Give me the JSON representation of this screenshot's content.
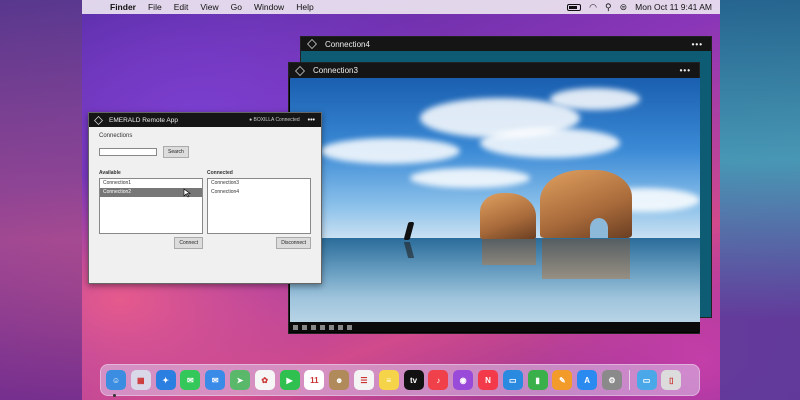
{
  "menubar": {
    "apple_glyph": "",
    "app_name": "Finder",
    "items": [
      "File",
      "Edit",
      "View",
      "Go",
      "Window",
      "Help"
    ],
    "date_time": "Mon Oct 11  9:41 AM"
  },
  "windows": {
    "connection4": {
      "title": "Connection4",
      "more": "•••"
    },
    "connection3": {
      "title": "Connection3",
      "more": "•••"
    }
  },
  "emerald_app": {
    "title": "EMERALD Remote App",
    "status": "● BOXILLA Connected",
    "more": "•••",
    "connections_label": "Connections",
    "search_value": "",
    "search_button": "Search",
    "available_label": "Available",
    "available_items": [
      "Connection1",
      "Connection2"
    ],
    "available_selected": 1,
    "connected_label": "Connected",
    "connected_items": [
      "Connection3",
      "Connection4"
    ],
    "connect_button": "Connect",
    "disconnect_button": "Disconnect"
  },
  "dock": {
    "apps": [
      {
        "name": "finder-icon",
        "color": "#3a8de0",
        "glyph": "☺"
      },
      {
        "name": "launchpad-icon",
        "color": "#d8d8e8",
        "glyph": "▦"
      },
      {
        "name": "safari-icon",
        "color": "#2a7fe0",
        "glyph": "✦"
      },
      {
        "name": "messages-icon",
        "color": "#34c759",
        "glyph": "✉"
      },
      {
        "name": "mail-icon",
        "color": "#3a8ae8",
        "glyph": "✉"
      },
      {
        "name": "maps-icon",
        "color": "#5ab86a",
        "glyph": "➤"
      },
      {
        "name": "photos-icon",
        "color": "#f6f6f6",
        "glyph": "✿"
      },
      {
        "name": "facetime-icon",
        "color": "#30c050",
        "glyph": "▶"
      },
      {
        "name": "calendar-icon",
        "color": "#ffffff",
        "glyph": "11"
      },
      {
        "name": "contacts-icon",
        "color": "#b08a5a",
        "glyph": "☻"
      },
      {
        "name": "reminders-icon",
        "color": "#f4f4f4",
        "glyph": "☰"
      },
      {
        "name": "notes-icon",
        "color": "#f6d44a",
        "glyph": "≡"
      },
      {
        "name": "tv-icon",
        "color": "#111111",
        "glyph": "tv"
      },
      {
        "name": "music-icon",
        "color": "#f0404a",
        "glyph": "♪"
      },
      {
        "name": "podcasts-icon",
        "color": "#9a4ad8",
        "glyph": "◉"
      },
      {
        "name": "news-icon",
        "color": "#f23a4a",
        "glyph": "N"
      },
      {
        "name": "keynote-icon",
        "color": "#2a8ae0",
        "glyph": "▭"
      },
      {
        "name": "numbers-icon",
        "color": "#3ab04a",
        "glyph": "▮"
      },
      {
        "name": "pages-icon",
        "color": "#f29a2a",
        "glyph": "✎"
      },
      {
        "name": "appstore-icon",
        "color": "#2a8af0",
        "glyph": "A"
      },
      {
        "name": "system-preferences-icon",
        "color": "#8a8a8a",
        "glyph": "⚙"
      }
    ],
    "trailing": [
      {
        "name": "downloads-folder-icon",
        "color": "#4aa8e8",
        "glyph": "▭"
      },
      {
        "name": "trash-icon",
        "color": "#dcdcdc",
        "glyph": "▯"
      }
    ]
  }
}
